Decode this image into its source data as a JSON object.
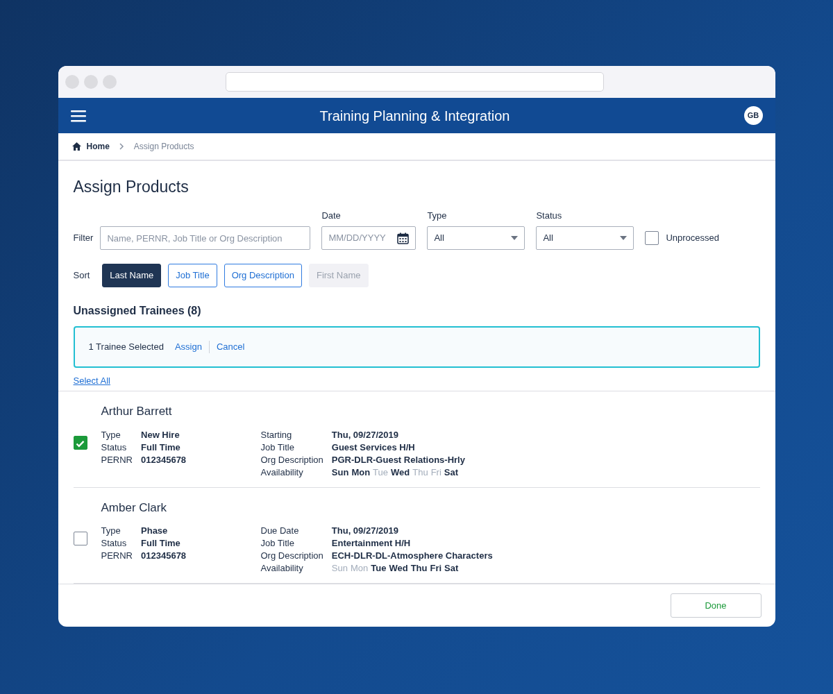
{
  "app_header": {
    "title": "Training Planning & Integration",
    "avatar": "GB"
  },
  "breadcrumb": [
    {
      "label": "Home"
    },
    {
      "label": "Assign Products"
    }
  ],
  "page_title": "Assign Products",
  "filters": {
    "filter_label": "Filter",
    "search": {
      "placeholder": "Name, PERNR, Job Title or Org Description"
    },
    "date": {
      "label": "Date",
      "placeholder": "MM/DD/YYYY"
    },
    "type": {
      "label": "Type",
      "value": "All"
    },
    "status": {
      "label": "Status",
      "value": "All"
    },
    "unprocessed": {
      "label": "Unprocessed",
      "checked": false
    }
  },
  "sort": {
    "label": "Sort",
    "options": [
      {
        "label": "Last Name",
        "selected": true,
        "disabled": false
      },
      {
        "label": "Job Title",
        "selected": false,
        "disabled": false
      },
      {
        "label": "Org Description",
        "selected": false,
        "disabled": false
      },
      {
        "label": "First Name",
        "selected": false,
        "disabled": true
      }
    ]
  },
  "section_title": "Unassigned Trainees (8)",
  "selection_bar": {
    "text": "1 Trainee Selected",
    "actions": [
      "Assign",
      "Cancel"
    ]
  },
  "select_all": "Select All",
  "trainees": [
    {
      "name": "Arthur Barrett",
      "checked": true,
      "left": [
        {
          "label": "Type",
          "value": "New Hire"
        },
        {
          "label": "Status",
          "value": "Full Time"
        },
        {
          "label": "PERNR",
          "value": "012345678"
        }
      ],
      "right": [
        {
          "label": "Starting",
          "value": "Thu, 09/27/2019"
        },
        {
          "label": "Job Title",
          "value": "Guest Services H/H"
        },
        {
          "label": "Org Description",
          "value": "PGR-DLR-Guest Relations-Hrly"
        }
      ],
      "availability_label": "Availability",
      "days": [
        {
          "day": "Sun",
          "available": true
        },
        {
          "day": "Mon",
          "available": true
        },
        {
          "day": "Tue",
          "available": false
        },
        {
          "day": "Wed",
          "available": true
        },
        {
          "day": "Thu",
          "available": false
        },
        {
          "day": "Fri",
          "available": false
        },
        {
          "day": "Sat",
          "available": true
        }
      ]
    },
    {
      "name": "Amber Clark",
      "checked": false,
      "left": [
        {
          "label": "Type",
          "value": "Phase"
        },
        {
          "label": "Status",
          "value": "Full Time"
        },
        {
          "label": "PERNR",
          "value": "012345678"
        }
      ],
      "right": [
        {
          "label": "Due Date",
          "value": "Thu, 09/27/2019"
        },
        {
          "label": "Job Title",
          "value": "Entertainment H/H"
        },
        {
          "label": "Org Description",
          "value": "ECH-DLR-DL-Atmosphere Characters"
        }
      ],
      "availability_label": "Availability",
      "days": [
        {
          "day": "Sun",
          "available": false
        },
        {
          "day": "Mon",
          "available": false
        },
        {
          "day": "Tue",
          "available": true
        },
        {
          "day": "Wed",
          "available": true
        },
        {
          "day": "Thu",
          "available": true
        },
        {
          "day": "Fri",
          "available": true
        },
        {
          "day": "Sat",
          "available": true
        }
      ]
    }
  ],
  "footer": {
    "done": "Done"
  }
}
